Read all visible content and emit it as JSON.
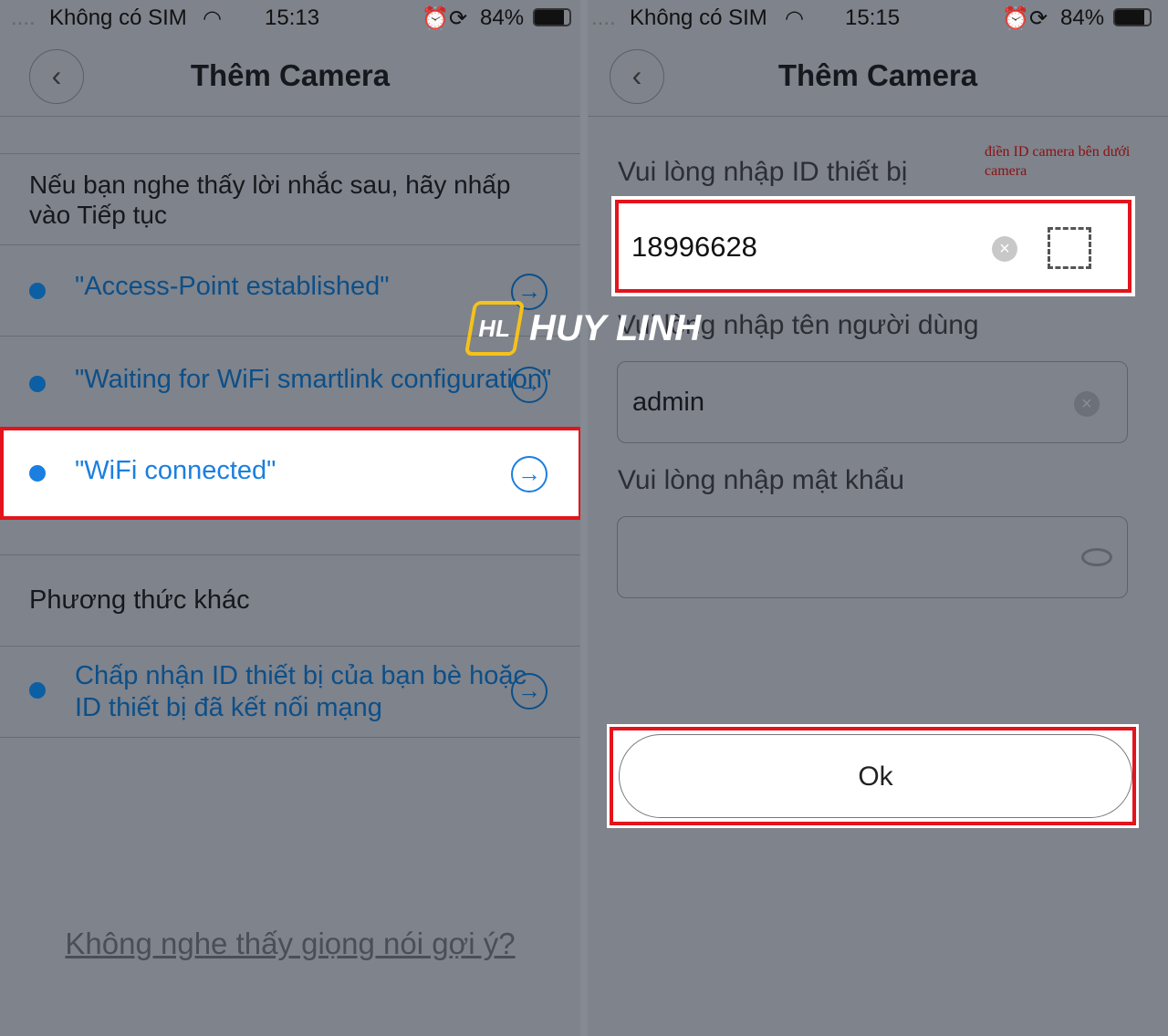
{
  "left": {
    "status": {
      "carrier": "Không có SIM",
      "time": "15:13",
      "battery": "84%"
    },
    "title": "Thêm Camera",
    "instruction": "Nếu bạn nghe thấy lời nhắc sau, hãy nhấp vào Tiếp tục",
    "prompts": [
      {
        "label": "\"Access-Point established\""
      },
      {
        "label": "\"Waiting for WiFi smartlink configuration\""
      },
      {
        "label": "\"WiFi connected\"",
        "highlighted": true
      }
    ],
    "other_heading": "Phương thức khác",
    "other_item": "Chấp nhận ID thiết bị của bạn bè hoặc ID thiết bị đã kết nối mạng",
    "help_link": "Không nghe thấy giọng nói gợi ý?"
  },
  "right": {
    "status": {
      "carrier": "Không có SIM",
      "time": "15:15",
      "battery": "84%"
    },
    "title": "Thêm Camera",
    "id_label": "Vui lòng nhập ID thiết bị",
    "annotation": "điền ID camera bên dưới camera",
    "id_value": "18996628",
    "user_label": "Vui lòng nhập tên người dùng",
    "user_value": "admin",
    "pass_label": "Vui lòng nhập mật khẩu",
    "pass_value": "",
    "ok": "Ok"
  },
  "watermark": "HUY LINH",
  "colors": {
    "highlight_border": "#e3141c",
    "link": "#1a7fe0",
    "overlay": "#7f838c"
  }
}
